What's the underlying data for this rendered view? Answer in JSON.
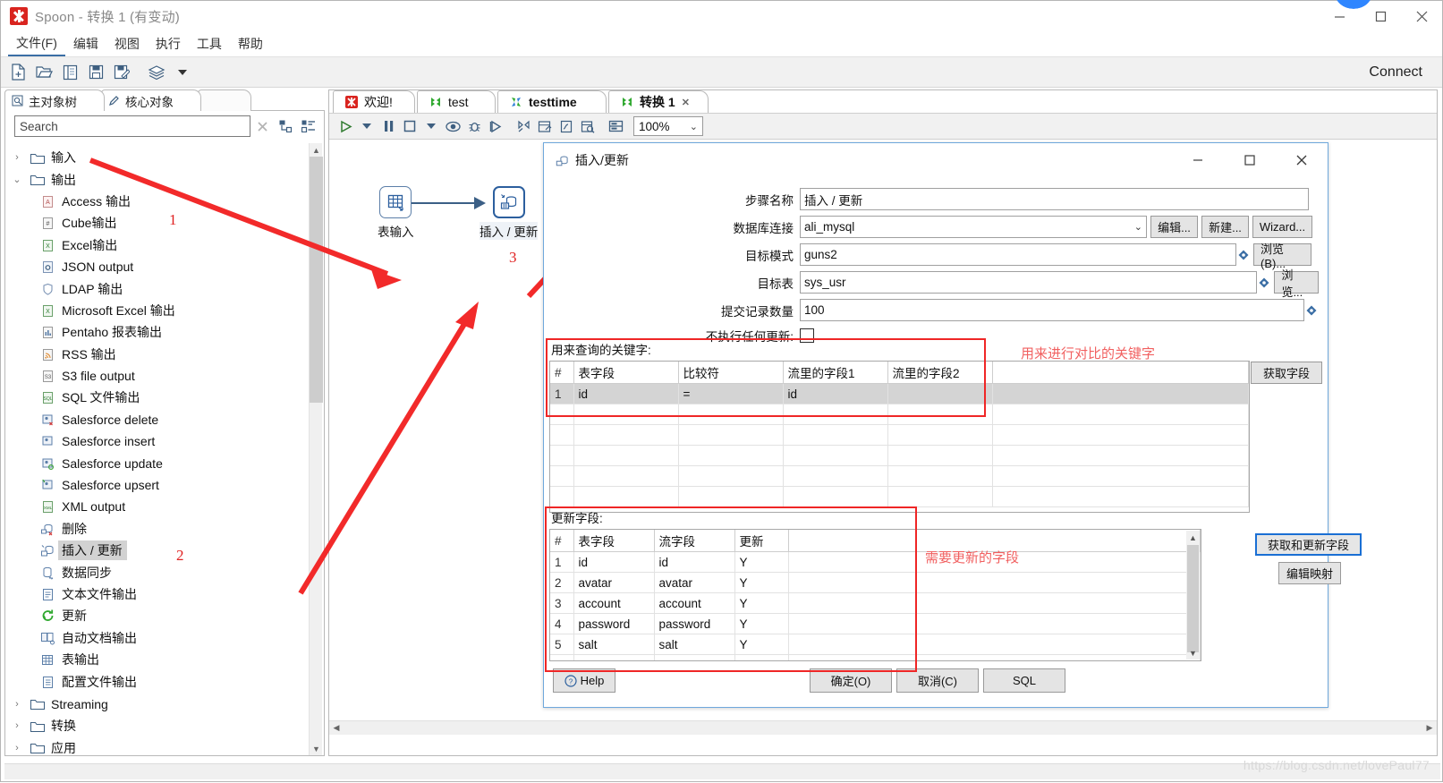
{
  "window": {
    "title": "Spoon - 转换 1 (有变动)",
    "app_icon": "spoon-logo-icon",
    "minimize": "−",
    "maximize": "□",
    "close": "✕"
  },
  "menubar": {
    "items": [
      {
        "label": "文件(F)",
        "active": true
      },
      {
        "label": "编辑",
        "active": false
      },
      {
        "label": "视图",
        "active": false
      },
      {
        "label": "执行",
        "active": false
      },
      {
        "label": "工具",
        "active": false
      },
      {
        "label": "帮助",
        "active": false
      }
    ]
  },
  "toolbar": {
    "icons": [
      "new-file-icon",
      "open-folder-icon",
      "explorer-icon",
      "save-icon",
      "save-as-icon",
      "layers-icon",
      "chevron-down-icon"
    ],
    "connect_label": "Connect"
  },
  "left_panel": {
    "tabs": [
      {
        "label": "主对象树",
        "icon": "tree-view-icon"
      },
      {
        "label": "核心对象",
        "icon": "pencil-icon"
      }
    ],
    "search": {
      "placeholder": "Search",
      "value": "",
      "clear_icon": "close-icon",
      "expand_all_icon": "expand-tree-icon",
      "collapse_all_icon": "collapse-tree-icon"
    },
    "tree": [
      {
        "label": "输入",
        "type": "folder",
        "expanded": false,
        "arrow": "›",
        "icon": "folder-icon"
      },
      {
        "label": "输出",
        "type": "folder",
        "expanded": true,
        "arrow": "⌄",
        "icon": "folder-icon"
      },
      {
        "label": "Access 输出",
        "type": "step",
        "icon": "access-output-icon"
      },
      {
        "label": "Cube输出",
        "type": "step",
        "icon": "cube-output-icon"
      },
      {
        "label": "Excel输出",
        "type": "step",
        "icon": "excel-output-icon"
      },
      {
        "label": "JSON output",
        "type": "step",
        "icon": "json-output-icon"
      },
      {
        "label": "LDAP 输出",
        "type": "step",
        "icon": "ldap-output-icon"
      },
      {
        "label": "Microsoft Excel 输出",
        "type": "step",
        "icon": "ms-excel-output-icon"
      },
      {
        "label": "Pentaho 报表输出",
        "type": "step",
        "icon": "pentaho-report-icon"
      },
      {
        "label": "RSS 输出",
        "type": "step",
        "icon": "rss-output-icon"
      },
      {
        "label": "S3 file output",
        "type": "step",
        "icon": "s3-output-icon"
      },
      {
        "label": "SQL 文件输出",
        "type": "step",
        "icon": "sql-file-output-icon"
      },
      {
        "label": "Salesforce delete",
        "type": "step",
        "icon": "salesforce-delete-icon"
      },
      {
        "label": "Salesforce insert",
        "type": "step",
        "icon": "salesforce-insert-icon"
      },
      {
        "label": "Salesforce update",
        "type": "step",
        "icon": "salesforce-update-icon"
      },
      {
        "label": "Salesforce upsert",
        "type": "step",
        "icon": "salesforce-upsert-icon"
      },
      {
        "label": "XML output",
        "type": "step",
        "icon": "xml-output-icon"
      },
      {
        "label": "删除",
        "type": "step",
        "icon": "delete-icon"
      },
      {
        "label": "插入 / 更新",
        "type": "step",
        "icon": "insert-update-icon",
        "selected": true
      },
      {
        "label": "数据同步",
        "type": "step",
        "icon": "sync-icon"
      },
      {
        "label": "文本文件输出",
        "type": "step",
        "icon": "text-file-output-icon"
      },
      {
        "label": "更新",
        "type": "step",
        "icon": "update-icon"
      },
      {
        "label": "自动文档输出",
        "type": "step",
        "icon": "auto-doc-output-icon"
      },
      {
        "label": "表输出",
        "type": "step",
        "icon": "table-output-icon"
      },
      {
        "label": "配置文件输出",
        "type": "step",
        "icon": "properties-output-icon"
      },
      {
        "label": "Streaming",
        "type": "folder",
        "expanded": false,
        "arrow": "›",
        "icon": "folder-icon"
      },
      {
        "label": "转换",
        "type": "folder",
        "expanded": false,
        "arrow": "›",
        "icon": "folder-icon"
      },
      {
        "label": "应用",
        "type": "folder",
        "expanded": false,
        "arrow": "›",
        "icon": "folder-icon"
      }
    ]
  },
  "canvas_panel": {
    "tabs": [
      {
        "label": "欢迎!",
        "icon": "spoon-logo-icon",
        "bold": false,
        "closable": false
      },
      {
        "label": "test",
        "icon": "transformation-icon",
        "bold": false,
        "closable": false
      },
      {
        "label": "testtime",
        "icon": "job-icon",
        "bold": true,
        "closable": false
      },
      {
        "label": "转换 1",
        "icon": "transformation-icon",
        "bold": true,
        "closable": true,
        "close_glyph": "✕"
      }
    ],
    "toolbar": {
      "icons": [
        "run-icon",
        "chevron-down-icon",
        "pause-icon",
        "stop-icon",
        "chevron-down-icon",
        "preview-icon",
        "debug-icon",
        "replay-icon",
        "transformation-icon",
        "metrics-icon",
        "sql-icon",
        "inspect-icon",
        "grid-icon"
      ],
      "zoom_value": "100%",
      "zoom_caret": "⌄"
    },
    "steps": [
      {
        "name": "表输入",
        "icon": "table-input-icon"
      },
      {
        "name": "插入 / 更新",
        "icon": "insert-update-icon",
        "selected": true
      }
    ]
  },
  "annotations": {
    "numbers": [
      "1",
      "2",
      "3"
    ],
    "note_keys": "用来进行对比的关键字",
    "note_update": "需要更新的字段"
  },
  "dialog": {
    "title": "插入/更新",
    "title_icon": "insert-update-icon",
    "minimize": "−",
    "maximize": "□",
    "close": "✕",
    "fields": [
      {
        "label": "步骤名称",
        "value": "插入 / 更新",
        "type": "text"
      },
      {
        "label": "数据库连接",
        "value": "ali_mysql",
        "type": "combo",
        "buttons": [
          "编辑...",
          "新建...",
          "Wizard..."
        ]
      },
      {
        "label": "目标模式",
        "value": "guns2",
        "type": "text-var",
        "button": "浏览(B)..."
      },
      {
        "label": "目标表",
        "value": "sys_usr",
        "type": "text-var",
        "button": "浏览..."
      },
      {
        "label": "提交记录数量",
        "value": "100",
        "type": "text-var"
      },
      {
        "label": "不执行任何更新:",
        "value": "",
        "type": "checkbox",
        "checked": false
      }
    ],
    "lookup_section": {
      "label": "用来查询的关键字:",
      "columns": [
        "#",
        "表字段",
        "比较符",
        "流里的字段1",
        "流里的字段2"
      ],
      "rows": [
        {
          "num": "1",
          "table_field": "id",
          "comparator": "=",
          "stream_field1": "id",
          "stream_field2": ""
        }
      ],
      "get_fields_button": "获取字段"
    },
    "update_section": {
      "label": "更新字段:",
      "columns": [
        "#",
        "表字段",
        "流字段",
        "更新",
        ""
      ],
      "rows": [
        {
          "num": "1",
          "table_field": "id",
          "stream_field": "id",
          "update": "Y"
        },
        {
          "num": "2",
          "table_field": "avatar",
          "stream_field": "avatar",
          "update": "Y"
        },
        {
          "num": "3",
          "table_field": "account",
          "stream_field": "account",
          "update": "Y"
        },
        {
          "num": "4",
          "table_field": "password",
          "stream_field": "password",
          "update": "Y"
        },
        {
          "num": "5",
          "table_field": "salt",
          "stream_field": "salt",
          "update": "Y"
        }
      ],
      "get_update_fields_button": "获取和更新字段",
      "edit_mapping_button": "编辑映射"
    },
    "footer": {
      "help": "Help",
      "ok": "确定(O)",
      "cancel": "取消(C)",
      "sql": "SQL"
    }
  },
  "watermark": "https://blog.csdn.net/lovePaul77"
}
